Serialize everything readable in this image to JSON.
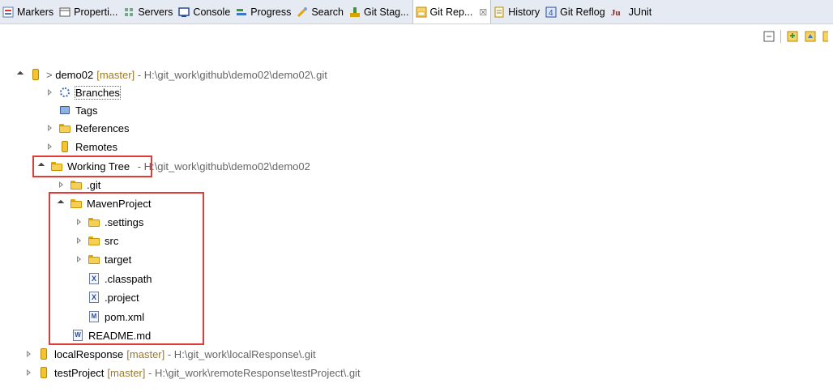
{
  "tabs": [
    {
      "label": "Markers",
      "icon": "markers-icon"
    },
    {
      "label": "Properti...",
      "icon": "properties-icon"
    },
    {
      "label": "Servers",
      "icon": "servers-icon"
    },
    {
      "label": "Console",
      "icon": "console-icon"
    },
    {
      "label": "Progress",
      "icon": "progress-icon"
    },
    {
      "label": "Search",
      "icon": "search-icon"
    },
    {
      "label": "Git Stag...",
      "icon": "git-staging-icon"
    },
    {
      "label": "Git Rep...",
      "icon": "git-repositories-icon",
      "active": true,
      "close": "☒"
    },
    {
      "label": "History",
      "icon": "history-icon"
    },
    {
      "label": "Git Reflog",
      "icon": "git-reflog-icon"
    },
    {
      "label": "JUnit",
      "icon": "junit-icon"
    }
  ],
  "toolbar": [
    "collapse-all-icon",
    "add-repository-icon",
    "clone-repository-icon",
    "create-repository-icon"
  ],
  "tree": {
    "demo02": {
      "prefix": "> ",
      "name": "demo02",
      "branch": "[master]",
      "path": " - H:\\git_work\\github\\demo02\\demo02\\.git"
    },
    "branches": "Branches",
    "tags": "Tags",
    "references": "References",
    "remotes": "Remotes",
    "working_tree": {
      "name": "Working Tree",
      "path": " - H:\\git_work\\github\\demo02\\demo02"
    },
    "git_folder": ".git",
    "maven_project": "MavenProject",
    "settings": ".settings",
    "src": "src",
    "target": "target",
    "classpath": ".classpath",
    "project": ".project",
    "pom": "pom.xml",
    "readme": "README.md",
    "local_response": {
      "name": "localResponse",
      "branch": "[master]",
      "path": " - H:\\git_work\\localResponse\\.git"
    },
    "test_project": {
      "name": "testProject",
      "branch": "[master]",
      "path": " - H:\\git_work\\remoteResponse\\testProject\\.git"
    }
  },
  "colors": {
    "highlight": "#e53935",
    "branch_ref": "#9a7a2a",
    "tab_bar": "#e6ebf3"
  }
}
